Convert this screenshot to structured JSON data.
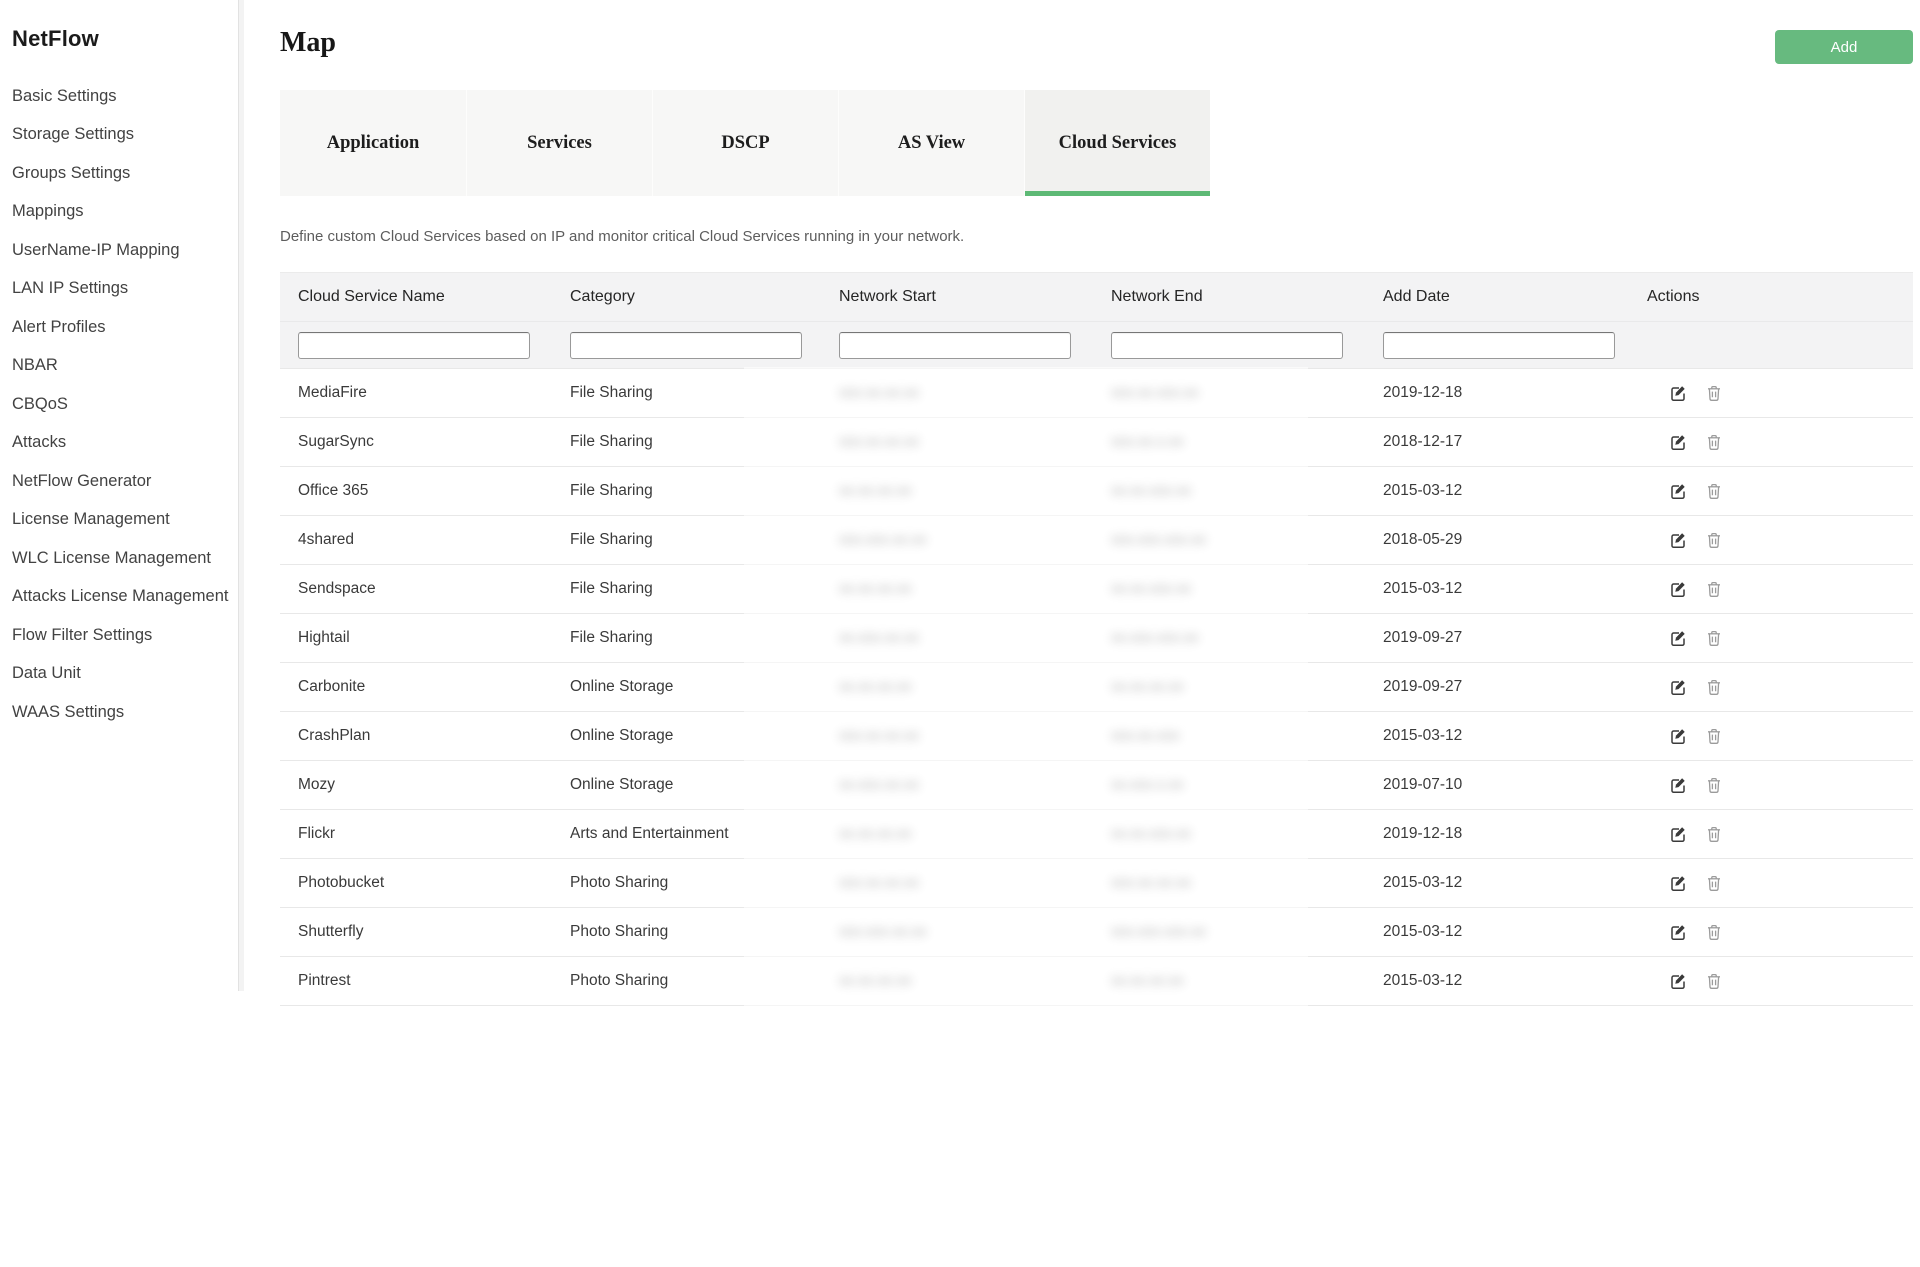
{
  "sidebar": {
    "title": "NetFlow",
    "items": [
      "Basic Settings",
      "Storage Settings",
      "Groups Settings",
      "Mappings",
      "UserName-IP Mapping",
      "LAN IP Settings",
      "Alert Profiles",
      "NBAR",
      "CBQoS",
      "Attacks",
      "NetFlow Generator",
      "License Management",
      "WLC License Management",
      "Attacks License Management",
      "Flow Filter Settings",
      "Data Unit",
      "WAAS Settings"
    ]
  },
  "page": {
    "title": "Map",
    "add_button_label": "Add"
  },
  "tabs": [
    {
      "label": "Application",
      "active": false
    },
    {
      "label": "Services",
      "active": false
    },
    {
      "label": "DSCP",
      "active": false
    },
    {
      "label": "AS View",
      "active": false
    },
    {
      "label": "Cloud Services",
      "active": true
    }
  ],
  "description": "Define custom Cloud Services based on IP and monitor critical Cloud Services running in your network.",
  "table": {
    "columns": [
      "Cloud Service Name",
      "Category",
      "Network Start",
      "Network End",
      "Add Date",
      "Actions"
    ],
    "rows": [
      {
        "name": "MediaFire",
        "category": "File Sharing",
        "network_start_redacted": "xxx.xx.xx.xx",
        "network_end_redacted": "xxx.xx.xxx.xx",
        "add_date": "2019-12-18"
      },
      {
        "name": "SugarSync",
        "category": "File Sharing",
        "network_start_redacted": "xxx.xx.xx.xx",
        "network_end_redacted": "xxx.xx.x.xx",
        "add_date": "2018-12-17"
      },
      {
        "name": "Office 365",
        "category": "File Sharing",
        "network_start_redacted": "xx.xx.xx.xx",
        "network_end_redacted": "xx.xx.xxx.xx",
        "add_date": "2015-03-12"
      },
      {
        "name": "4shared",
        "category": "File Sharing",
        "network_start_redacted": "xxx.xxx.xx.xx",
        "network_end_redacted": "xxx.xxx.xxx.xx",
        "add_date": "2018-05-29"
      },
      {
        "name": "Sendspace",
        "category": "File Sharing",
        "network_start_redacted": "xx.xx.xx.xx",
        "network_end_redacted": "xx.xx.xxx.xx",
        "add_date": "2015-03-12"
      },
      {
        "name": "Hightail",
        "category": "File Sharing",
        "network_start_redacted": "xx.xxx.xx.xx",
        "network_end_redacted": "xx.xxx.xxx.xx",
        "add_date": "2019-09-27"
      },
      {
        "name": "Carbonite",
        "category": "Online Storage",
        "network_start_redacted": "xx.xx.xx.xx",
        "network_end_redacted": "xx.xx.xx.xx",
        "add_date": "2019-09-27"
      },
      {
        "name": "CrashPlan",
        "category": "Online Storage",
        "network_start_redacted": "xxx.xx.xx.xx",
        "network_end_redacted": "xxx.xx.xxx",
        "add_date": "2015-03-12"
      },
      {
        "name": "Mozy",
        "category": "Online Storage",
        "network_start_redacted": "xx.xxx.xx.xx",
        "network_end_redacted": "xx.xxx.x.xx",
        "add_date": "2019-07-10"
      },
      {
        "name": "Flickr",
        "category": "Arts and Entertainment",
        "network_start_redacted": "xx.xx.xx.xx",
        "network_end_redacted": "xx.xx.xxx.xx",
        "add_date": "2019-12-18"
      },
      {
        "name": "Photobucket",
        "category": "Photo Sharing",
        "network_start_redacted": "xxx.xx.xx.xx",
        "network_end_redacted": "xxx.xx.xx.xx",
        "add_date": "2015-03-12"
      },
      {
        "name": "Shutterfly",
        "category": "Photo Sharing",
        "network_start_redacted": "xxx.xxx.xx.xx",
        "network_end_redacted": "xxx.xxx.xxx.xx",
        "add_date": "2015-03-12"
      },
      {
        "name": "Pintrest",
        "category": "Photo Sharing",
        "network_start_redacted": "xx.xx.xx.xx",
        "network_end_redacted": "xx.xx.xx.xx",
        "add_date": "2015-03-12"
      }
    ]
  },
  "icons": {
    "edit": "edit-pencil-square-icon",
    "delete": "trash-icon"
  },
  "colors": {
    "accent_green": "#67ba7f",
    "tab_underline_green": "#5db975",
    "tab_bg": "#f7f7f6",
    "active_tab_bg": "#f1f1ef",
    "table_band_bg": "#f3f3f4"
  }
}
